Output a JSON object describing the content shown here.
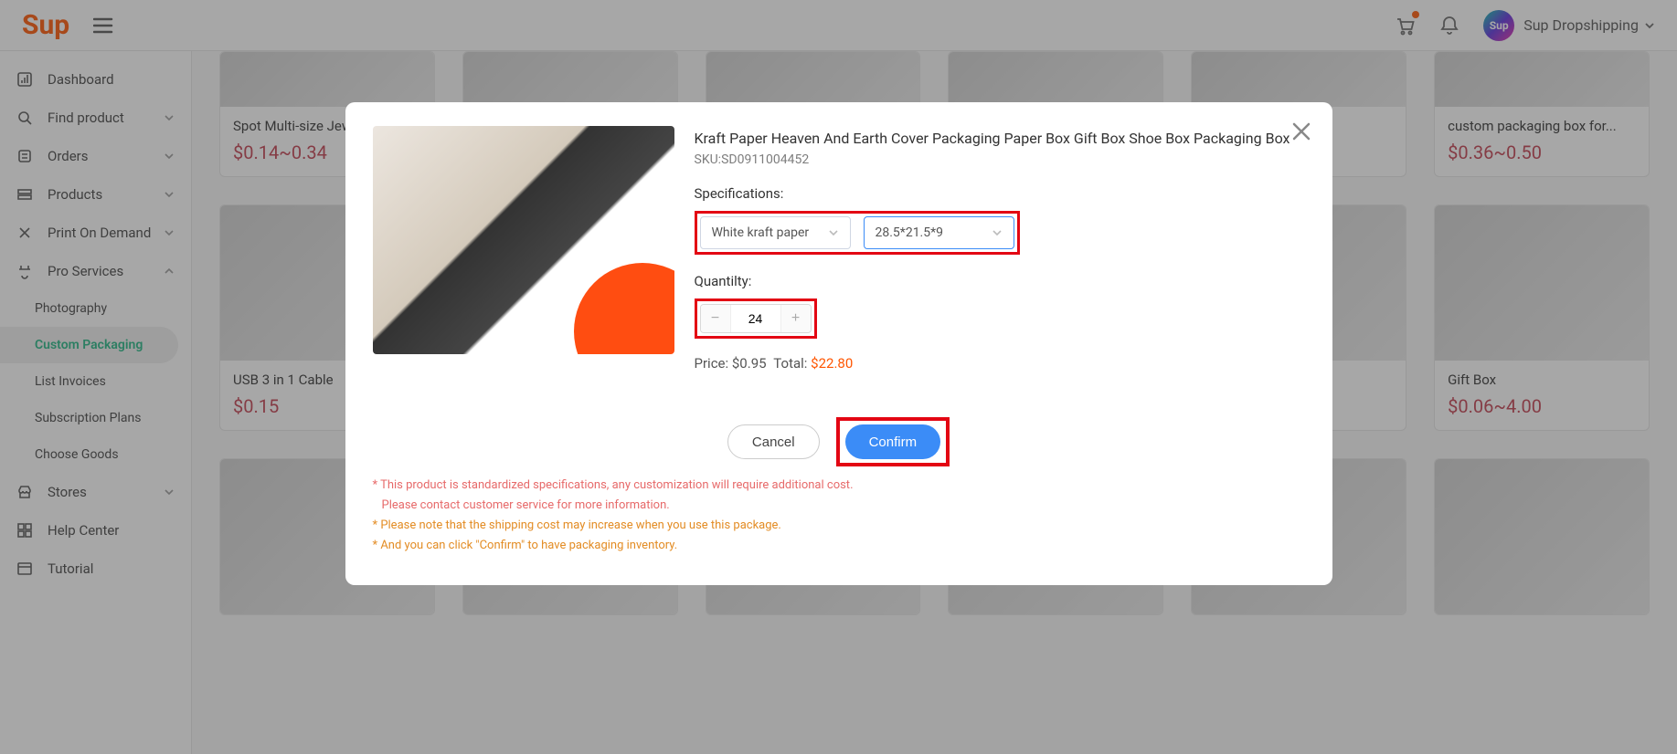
{
  "header": {
    "logo": "Sup",
    "user_label": "Sup Dropshipping"
  },
  "sidebar": {
    "items": [
      {
        "label": "Dashboard",
        "icon": "dashboard"
      },
      {
        "label": "Find product",
        "icon": "search",
        "caret": true
      },
      {
        "label": "Orders",
        "icon": "orders",
        "caret": true
      },
      {
        "label": "Products",
        "icon": "products",
        "caret": true
      },
      {
        "label": "Print On Demand",
        "icon": "pod",
        "caret": true
      },
      {
        "label": "Pro Services",
        "icon": "proservices",
        "caret": true,
        "expanded": true,
        "sub": [
          {
            "label": "Photography"
          },
          {
            "label": "Custom Packaging",
            "active": true
          },
          {
            "label": "List Invoices"
          },
          {
            "label": "Subscription Plans"
          },
          {
            "label": "Choose Goods"
          }
        ]
      },
      {
        "label": "Stores",
        "icon": "stores",
        "caret": true
      },
      {
        "label": "Help Center",
        "icon": "help"
      },
      {
        "label": "Tutorial",
        "icon": "tutorial"
      }
    ]
  },
  "products_row1": [
    {
      "title": "Spot Multi-size Jewelry Box",
      "price": "$0.14~0.34"
    },
    {
      "title": "",
      "price": ""
    },
    {
      "title": "",
      "price": ""
    },
    {
      "title": "",
      "price": ""
    },
    {
      "title": "",
      "price": ""
    },
    {
      "title": "custom packaging box for...",
      "price": "$0.36~0.50"
    }
  ],
  "products_row2": [
    {
      "title": "USB 3 in 1 Cable",
      "price": "$0.15"
    },
    {
      "title": "",
      "price": ""
    },
    {
      "title": "",
      "price": ""
    },
    {
      "title": "",
      "price": ""
    },
    {
      "title": "",
      "price": ""
    },
    {
      "title": "Gift Box",
      "price": "$0.06~4.00"
    }
  ],
  "modal": {
    "title": "Kraft Paper Heaven And Earth Cover Packaging Paper Box Gift Box Shoe Box Packaging Box",
    "sku_label": "SKU:",
    "sku": "SD0911004452",
    "spec_label": "Specifications:",
    "spec1": "White kraft paper",
    "spec2": "28.5*21.5*9",
    "qty_label": "Quantilty:",
    "qty": "24",
    "price_label": "Price:",
    "price": "$0.95",
    "total_label": "Total:",
    "total": "$22.80",
    "cancel": "Cancel",
    "confirm": "Confirm",
    "notice1a": "* This product is standardized specifications, any customization will require additional cost.",
    "notice1b": "Please contact customer service for more information.",
    "notice2": "* Please note that the shipping cost may increase when you use this package.",
    "notice3": "* And you can click \"Confirm\" to have packaging inventory."
  }
}
